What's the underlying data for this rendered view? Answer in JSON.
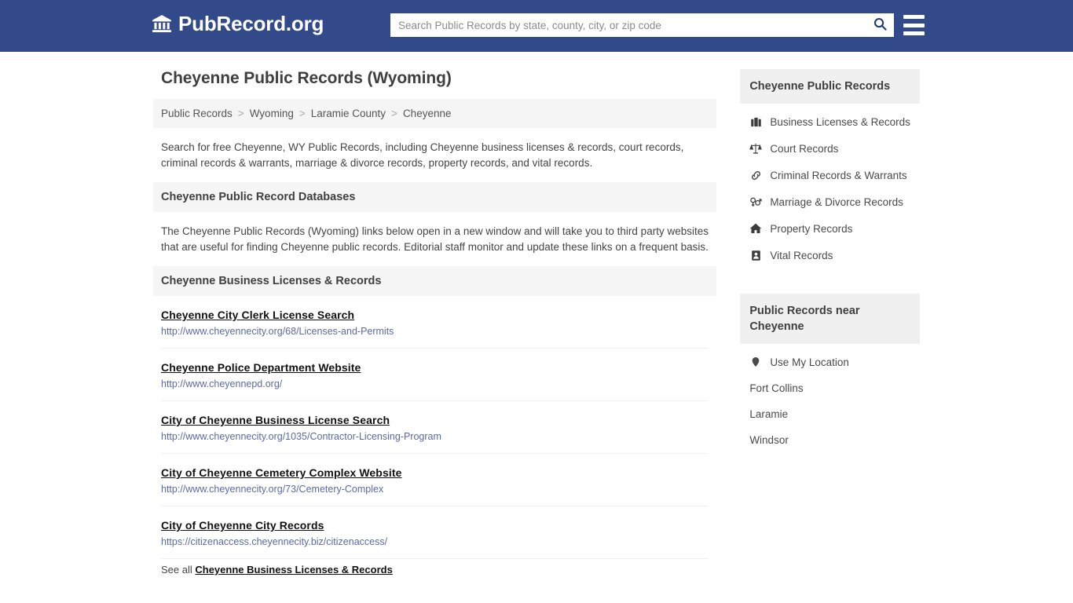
{
  "header": {
    "brand_name": "PubRecord.org",
    "brand_icon": "bank-building-icon",
    "search_placeholder": "Search Public Records by state, county, city, or zip code",
    "search_value": "",
    "search_icon": "search-icon",
    "menu_icon": "hamburger-menu-icon",
    "brand_bg": "#334a8a"
  },
  "main": {
    "page_title": "Cheyenne Public Records (Wyoming)",
    "breadcrumb": [
      {
        "label": "Public Records",
        "current": false
      },
      {
        "label": "Wyoming",
        "current": false
      },
      {
        "label": "Laramie County",
        "current": false
      },
      {
        "label": "Cheyenne",
        "current": true
      }
    ],
    "breadcrumb_separator": ">",
    "intro": "Search for free Cheyenne, WY Public Records, including Cheyenne business licenses & records, court records, criminal records & warrants, marriage & divorce records, property records, and vital records.",
    "databases_heading": "Cheyenne Public Record Databases",
    "databases_body": "The Cheyenne Public Records (Wyoming) links below open in a new window and will take you to third party websites that are useful for finding Cheyenne public records. Editorial staff monitor and update these links on a frequent basis.",
    "business_heading": "Cheyenne Business Licenses & Records",
    "links": [
      {
        "title": "Cheyenne City Clerk License Search",
        "url": "http://www.cheyennecity.org/68/Licenses-and-Permits"
      },
      {
        "title": "Cheyenne Police Department Website",
        "url": "http://www.cheyennepd.org/"
      },
      {
        "title": "City of Cheyenne Business License Search",
        "url": "http://www.cheyennecity.org/1035/Contractor-Licensing-Program"
      },
      {
        "title": "City of Cheyenne Cemetery Complex Website",
        "url": "http://www.cheyennecity.org/73/Cemetery-Complex"
      },
      {
        "title": "City of Cheyenne City Records",
        "url": "https://citizenaccess.cheyennecity.biz/citizenaccess/"
      }
    ],
    "see_all_prefix": "See all",
    "see_all_link": "Cheyenne Business Licenses & Records"
  },
  "sidebar": {
    "records_heading": "Cheyenne Public Records",
    "records_items": [
      {
        "label": "Business Licenses & Records",
        "icon": "briefcase-icon"
      },
      {
        "label": "Court Records",
        "icon": "scales-of-justice-icon"
      },
      {
        "label": "Criminal Records & Warrants",
        "icon": "handcuffs-icon"
      },
      {
        "label": "Marriage & Divorce Records",
        "icon": "gender-symbols-icon"
      },
      {
        "label": "Property Records",
        "icon": "home-icon"
      },
      {
        "label": "Vital Records",
        "icon": "id-card-icon"
      }
    ],
    "near_heading": "Public Records near Cheyenne",
    "near_items": [
      {
        "label": "Use My Location",
        "icon": "map-pin-icon"
      },
      {
        "label": "Fort Collins",
        "icon": ""
      },
      {
        "label": "Laramie",
        "icon": ""
      },
      {
        "label": "Windsor",
        "icon": ""
      }
    ]
  }
}
